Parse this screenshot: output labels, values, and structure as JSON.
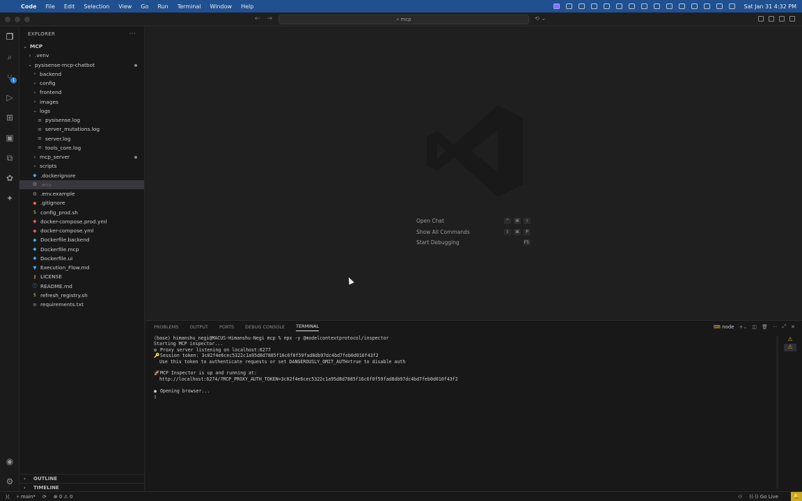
{
  "menubar": {
    "app": "Code",
    "items": [
      "File",
      "Edit",
      "Selection",
      "View",
      "Go",
      "Run",
      "Terminal",
      "Window",
      "Help"
    ],
    "clock": "Sat Jan 31  4:32 PM"
  },
  "titlebar": {
    "search": "mcp"
  },
  "explorer": {
    "title": "EXPLORER",
    "root": "MCP",
    "items": [
      {
        "label": ".venv",
        "indent": 1,
        "kind": "folder",
        "open": false
      },
      {
        "label": "pysisense-mcp-chatbot",
        "indent": 1,
        "kind": "folder",
        "open": true,
        "dot": true
      },
      {
        "label": "backend",
        "indent": 2,
        "kind": "folder",
        "open": false
      },
      {
        "label": "config",
        "indent": 2,
        "kind": "folder",
        "open": false
      },
      {
        "label": "frontend",
        "indent": 2,
        "kind": "folder",
        "open": false
      },
      {
        "label": "images",
        "indent": 2,
        "kind": "folder",
        "open": false
      },
      {
        "label": "logs",
        "indent": 2,
        "kind": "folder",
        "open": true
      },
      {
        "label": "pysisense.log",
        "indent": 3,
        "kind": "log"
      },
      {
        "label": "server_mutations.log",
        "indent": 3,
        "kind": "log"
      },
      {
        "label": "server.log",
        "indent": 3,
        "kind": "log"
      },
      {
        "label": "tools_core.log",
        "indent": 3,
        "kind": "log"
      },
      {
        "label": "mcp_server",
        "indent": 2,
        "kind": "folder",
        "open": false,
        "dot": true
      },
      {
        "label": "scripts",
        "indent": 2,
        "kind": "folder",
        "open": false
      },
      {
        "label": ".dockerignore",
        "indent": 2,
        "kind": "docker"
      },
      {
        "label": ".env",
        "indent": 2,
        "kind": "gear",
        "selected": true,
        "dim": true
      },
      {
        "label": ".env.example",
        "indent": 2,
        "kind": "gear"
      },
      {
        "label": ".gitignore",
        "indent": 2,
        "kind": "git"
      },
      {
        "label": "config_prod.sh",
        "indent": 2,
        "kind": "shell"
      },
      {
        "label": "docker-compose.prod.yml",
        "indent": 2,
        "kind": "compose"
      },
      {
        "label": "docker-compose.yml",
        "indent": 2,
        "kind": "compose"
      },
      {
        "label": "Dockerfile.backend",
        "indent": 2,
        "kind": "docker"
      },
      {
        "label": "Dockerfile.mcp",
        "indent": 2,
        "kind": "docker"
      },
      {
        "label": "Dockerfile.ui",
        "indent": 2,
        "kind": "docker"
      },
      {
        "label": "Execution_Flow.md",
        "indent": 2,
        "kind": "md"
      },
      {
        "label": "LICENSE",
        "indent": 2,
        "kind": "license"
      },
      {
        "label": "README.md",
        "indent": 2,
        "kind": "info"
      },
      {
        "label": "refresh_registry.sh",
        "indent": 2,
        "kind": "shell"
      },
      {
        "label": "requirements.txt",
        "indent": 2,
        "kind": "txt"
      }
    ],
    "outline": "OUTLINE",
    "timeline": "TIMELINE"
  },
  "editor": {
    "hints": [
      {
        "label": "Open Chat",
        "keys": [
          "^",
          "⌘",
          "I"
        ]
      },
      {
        "label": "Show All Commands",
        "keys": [
          "⇧",
          "⌘",
          "P"
        ]
      },
      {
        "label": "Start Debugging",
        "keys": [
          "F5"
        ]
      }
    ]
  },
  "panel": {
    "tabs": [
      "PROBLEMS",
      "OUTPUT",
      "PORTS",
      "DEBUG CONSOLE",
      "TERMINAL"
    ],
    "active_tab": "TERMINAL",
    "terminal_name": "node",
    "lines": [
      {
        "icon": "",
        "text": "(base) himanshu_negi@MACUS-Himanshu-Negi mcp % npx -y @modelcontextprotocol/inspector"
      },
      {
        "icon": "",
        "text": "Starting MCP inspector..."
      },
      {
        "icon": "⚙",
        "text": "Proxy server listening on localhost:6277"
      },
      {
        "icon": "🔑",
        "text": "Session token: 3c02f4e6cec5322c1a95d8d7885f16c6f0f59fad8db97dc4bd7feb0d010f43f2"
      },
      {
        "icon": "",
        "text": "  Use this token to authenticate requests or set DANGEROUSLY_OMIT_AUTH=true to disable auth"
      },
      {
        "icon": "",
        "text": ""
      },
      {
        "icon": "🚀",
        "text": "MCP Inspector is up and running at:"
      },
      {
        "icon": "",
        "text": "  http://localhost:6274/?MCP_PROXY_AUTH_TOKEN=3c02f4e6cec5322c1a95d8d7885f16c6f0f59fad8db97dc4bd7feb0d010f43f2"
      },
      {
        "icon": "",
        "text": ""
      },
      {
        "icon": "●",
        "text": "Opening browser..."
      },
      {
        "icon": "▯",
        "text": ""
      }
    ]
  },
  "status": {
    "branch": "main*",
    "errors": "0",
    "warnings": "0",
    "golive": "Go Live"
  },
  "colors": {
    "accent": "#2f7fd6",
    "menubar": "#20508f",
    "warning": "#d4a33a"
  }
}
